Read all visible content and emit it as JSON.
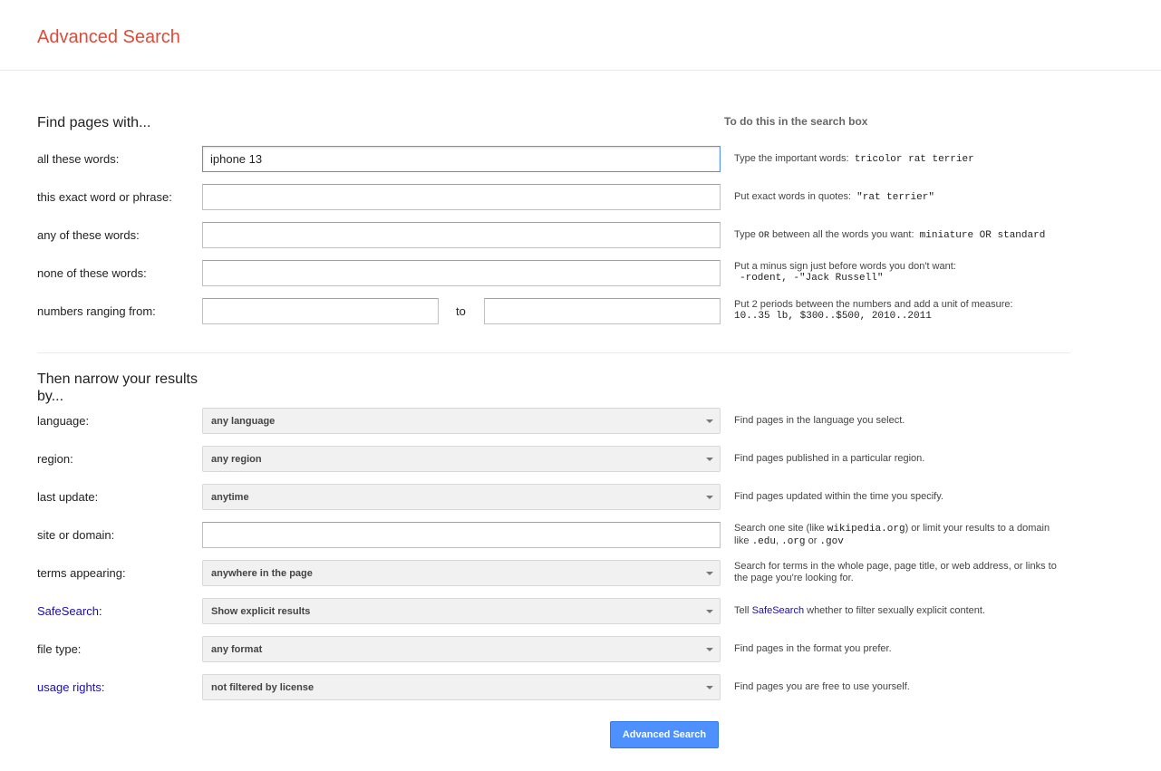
{
  "header": {
    "title": "Advanced Search"
  },
  "find_section": {
    "heading": "Find pages with...",
    "hint_heading": "To do this in the search box",
    "rows": [
      {
        "label": "all these words:",
        "value": "iphone 13",
        "hint_text": "Type the important words:",
        "hint_example": "tricolor rat terrier"
      },
      {
        "label": "this exact word or phrase:",
        "value": "",
        "hint_text": "Put exact words in quotes:",
        "hint_example": "\"rat terrier\""
      },
      {
        "label": "any of these words:",
        "value": "",
        "hint_text_1": "Type",
        "hint_or": "OR",
        "hint_text_2": "between all the words you want:",
        "hint_example": "miniature OR standard"
      },
      {
        "label": "none of these words:",
        "value": "",
        "hint_text": "Put a minus sign just before words you don't want:",
        "hint_example": "-rodent, -\"Jack Russell\""
      },
      {
        "label": "numbers ranging from:",
        "value_from": "",
        "to_label": "to",
        "value_to": "",
        "hint_text": "Put 2 periods between the numbers and add a unit of measure:",
        "hint_example": "10..35 lb, $300..$500, 2010..2011"
      }
    ]
  },
  "narrow_section": {
    "heading": "Then narrow your results by...",
    "language": {
      "label": "language:",
      "selected": "any language",
      "hint": "Find pages in the language you select."
    },
    "region": {
      "label": "region:",
      "selected": "any region",
      "hint": "Find pages published in a particular region."
    },
    "last_update": {
      "label": "last update:",
      "selected": "anytime",
      "hint": "Find pages updated within the time you specify."
    },
    "site": {
      "label": "site or domain:",
      "value": "",
      "hint_1": "Search one site (like",
      "hint_example_1": "wikipedia.org",
      "hint_2": ") or limit your results to a domain like",
      "hint_example_2": ".edu",
      "hint_3": ",",
      "hint_example_3": ".org",
      "hint_4": "or",
      "hint_example_4": ".gov"
    },
    "terms": {
      "label": "terms appearing:",
      "selected": "anywhere in the page",
      "hint": "Search for terms in the whole page, page title, or web address, or links to the page you're looking for."
    },
    "safesearch": {
      "label_link": "SafeSearch",
      "label_suffix": ":",
      "selected": "Show explicit results",
      "hint_1": "Tell",
      "hint_link": "SafeSearch",
      "hint_2": "whether to filter sexually explicit content."
    },
    "file_type": {
      "label": "file type:",
      "selected": "any format",
      "hint": "Find pages in the format you prefer."
    },
    "usage_rights": {
      "label_link": "usage rights",
      "label_suffix": ":",
      "selected": "not filtered by license",
      "hint": "Find pages you are free to use yourself."
    }
  },
  "submit": {
    "label": "Advanced Search"
  },
  "colors": {
    "title": "#dd4b39",
    "link": "#1a0dab",
    "button": "#4d90fe",
    "focus_border": "#4d90fe"
  }
}
